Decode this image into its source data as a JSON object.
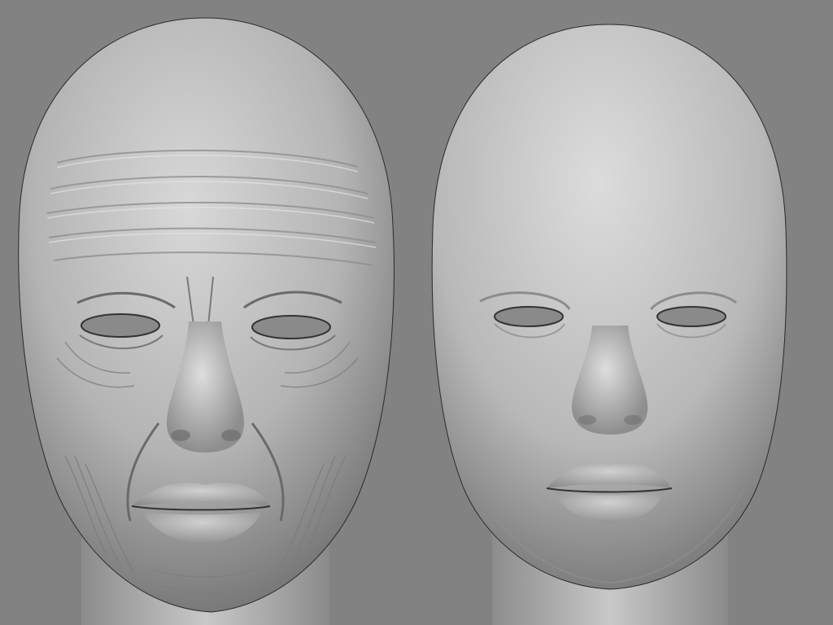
{
  "scene": {
    "background_color": "#828282",
    "models": [
      {
        "name": "aged-head-sculpt",
        "detail": "wrinkled"
      },
      {
        "name": "smooth-head-sculpt",
        "detail": "smooth"
      }
    ]
  },
  "colors": {
    "clay_light": "#d6d6d6",
    "clay_mid": "#a9a9a9",
    "clay_dark": "#5e5e5e",
    "eye_hole": "#8a8a8a",
    "outline": "#2a2a2a"
  }
}
